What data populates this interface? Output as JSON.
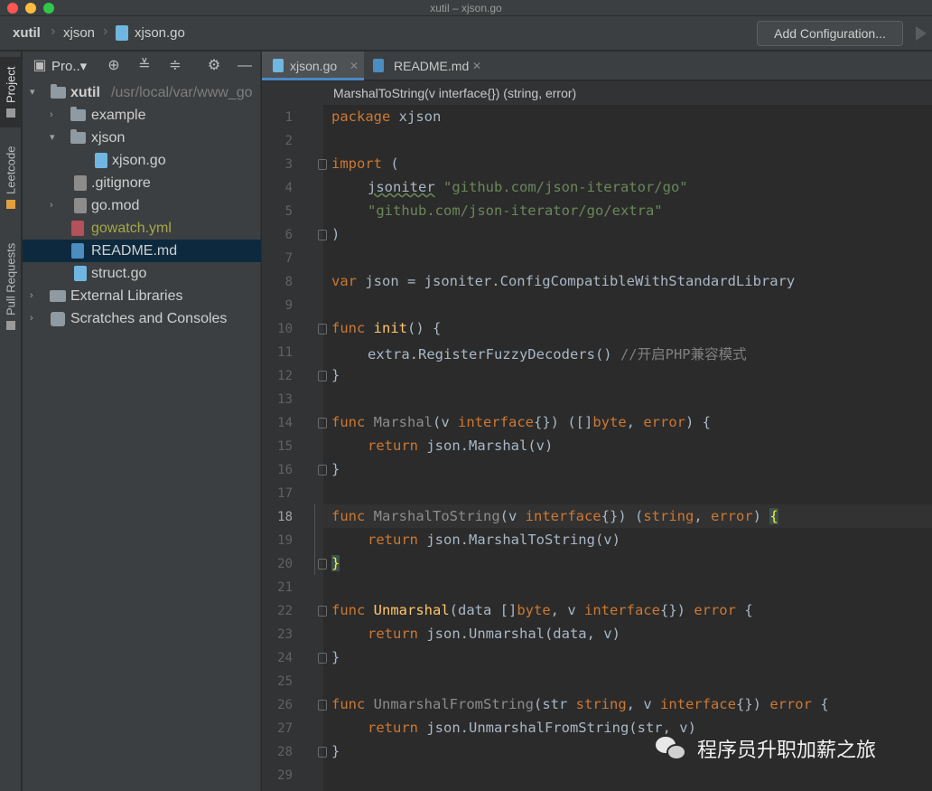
{
  "window": {
    "title": "xutil – xjson.go"
  },
  "navbar": {
    "project": "xutil",
    "folder": "xjson",
    "file": "xjson.go",
    "add_config": "Add Configuration..."
  },
  "stripe": {
    "project": "Project",
    "leetcode": "Leetcode",
    "pull_requests": "Pull Requests"
  },
  "project_panel": {
    "title": "Pro..▾",
    "tree": {
      "root_name": "xutil",
      "root_path": "/usr/local/var/www_go",
      "example": "example",
      "xjson": "xjson",
      "xjson_go": "xjson.go",
      "gitignore": ".gitignore",
      "gomod": "go.mod",
      "gowatch": "gowatch.yml",
      "readme": "README.md",
      "struct": "struct.go",
      "external": "External Libraries",
      "scratches": "Scratches and Consoles"
    }
  },
  "tabs": [
    {
      "label": "xjson.go",
      "active": true
    },
    {
      "label": "README.md",
      "active": false
    }
  ],
  "editor": {
    "breadcrumb": "MarshalToString(v interface{}) (string, error)",
    "current_line": 18,
    "line_numbers": [
      "1",
      "2",
      "3",
      "4",
      "5",
      "6",
      "7",
      "8",
      "9",
      "10",
      "11",
      "12",
      "13",
      "14",
      "15",
      "16",
      "17",
      "18",
      "19",
      "20",
      "21",
      "22",
      "23",
      "24",
      "25",
      "26",
      "27",
      "28",
      "29"
    ],
    "code": {
      "l1_kw": "package",
      "l1_name": " xjson",
      "l3_kw": "import",
      "l3_rest": " (",
      "l4_alias": "jsoniter",
      "l4_str": "\"github.com/json-iterator/go\"",
      "l5_str": "\"github.com/json-iterator/go/extra\"",
      "l6": ")",
      "l8_kw": "var",
      "l8_rest": " json = jsoniter.ConfigCompatibleWithStandardLibrary",
      "l10_kw": "func",
      "l10_fn": "init",
      "l10_rest": "() {",
      "l11_call": "extra.RegisterFuzzyDecoders()",
      "l11_cmt": " //开启PHP兼容模式",
      "l12": "}",
      "l14_kw": "func",
      "l14_fn": "Marshal",
      "l14_p1": "(v ",
      "l14_kw2": "interface",
      "l14_p2": "{}) ([]",
      "l14_kw3": "byte",
      "l14_p3": ", ",
      "l14_kw4": "error",
      "l14_p4": ") {",
      "l15_kw": "return",
      "l15_rest": " json.Marshal(v)",
      "l16": "}",
      "l18_kw": "func",
      "l18_fn": "MarshalToString",
      "l18_p1": "(v ",
      "l18_kw2": "interface",
      "l18_p2": "{}) (",
      "l18_kw3": "string",
      "l18_p3": ", ",
      "l18_kw4": "error",
      "l18_p4": ") ",
      "l18_br": "{",
      "l19_kw": "return",
      "l19_rest": " json.MarshalToString(v)",
      "l20": "}",
      "l22_kw": "func",
      "l22_fn": "Unmarshal",
      "l22_p1": "(data []",
      "l22_kw2": "byte",
      "l22_p2": ", v ",
      "l22_kw3": "interface",
      "l22_p3": "{}) ",
      "l22_kw4": "error",
      "l22_p4": " {",
      "l23_kw": "return",
      "l23_rest": " json.Unmarshal(data, v)",
      "l24": "}",
      "l26_kw": "func",
      "l26_fn": "UnmarshalFromString",
      "l26_p1": "(str ",
      "l26_kw2": "string",
      "l26_p2": ", v ",
      "l26_kw3": "interface",
      "l26_p3": "{}) ",
      "l26_kw4": "error",
      "l26_p4": " {",
      "l27_kw": "return",
      "l27_rest": " json.UnmarshalFromString(str, v)",
      "l28": "}"
    }
  },
  "watermark": {
    "text": "程序员升职加薪之旅"
  }
}
